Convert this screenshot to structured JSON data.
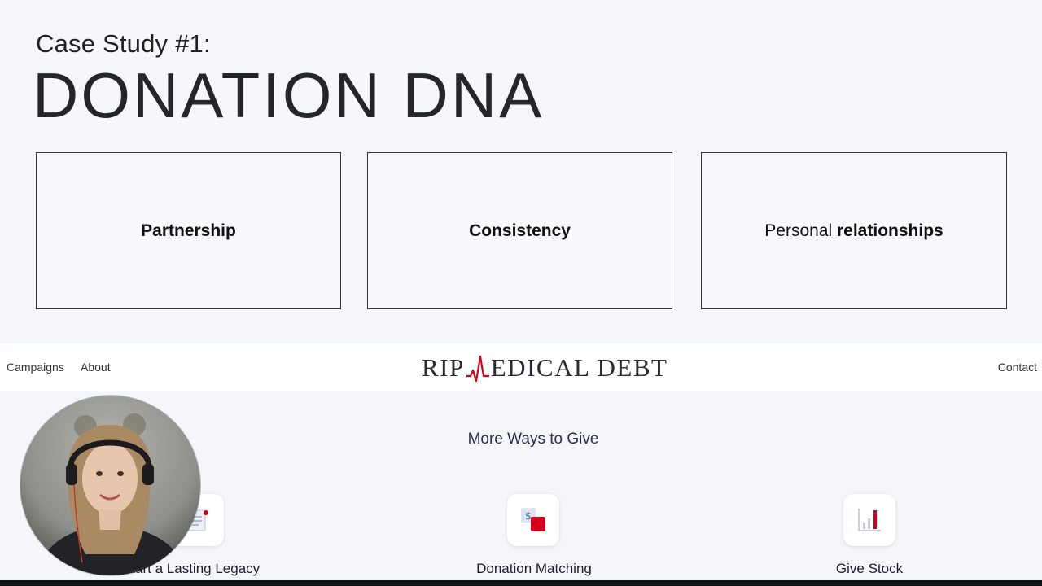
{
  "slide": {
    "subtitle": "Case Study #1:",
    "title": "DONATION DNA",
    "boxes": [
      {
        "bold": "Partnership"
      },
      {
        "bold": "Consistency"
      },
      {
        "light": "Personal ",
        "bold": "relationships"
      }
    ]
  },
  "navbar": {
    "links": {
      "campaigns": "Campaigns",
      "about": "About",
      "contact": "Contact"
    },
    "logo": {
      "left": "RIP",
      "right": "EDICAL DEBT"
    }
  },
  "ways": {
    "title": "More Ways to Give",
    "items": [
      {
        "label": "Start a Lasting Legacy",
        "icon": "document-icon"
      },
      {
        "label": "Donation Matching",
        "icon": "matching-icon"
      },
      {
        "label": "Give Stock",
        "icon": "chart-icon"
      }
    ]
  },
  "colors": {
    "accent": "#d0021b",
    "background": "#f6f7fb",
    "text": "#1e1e22"
  }
}
